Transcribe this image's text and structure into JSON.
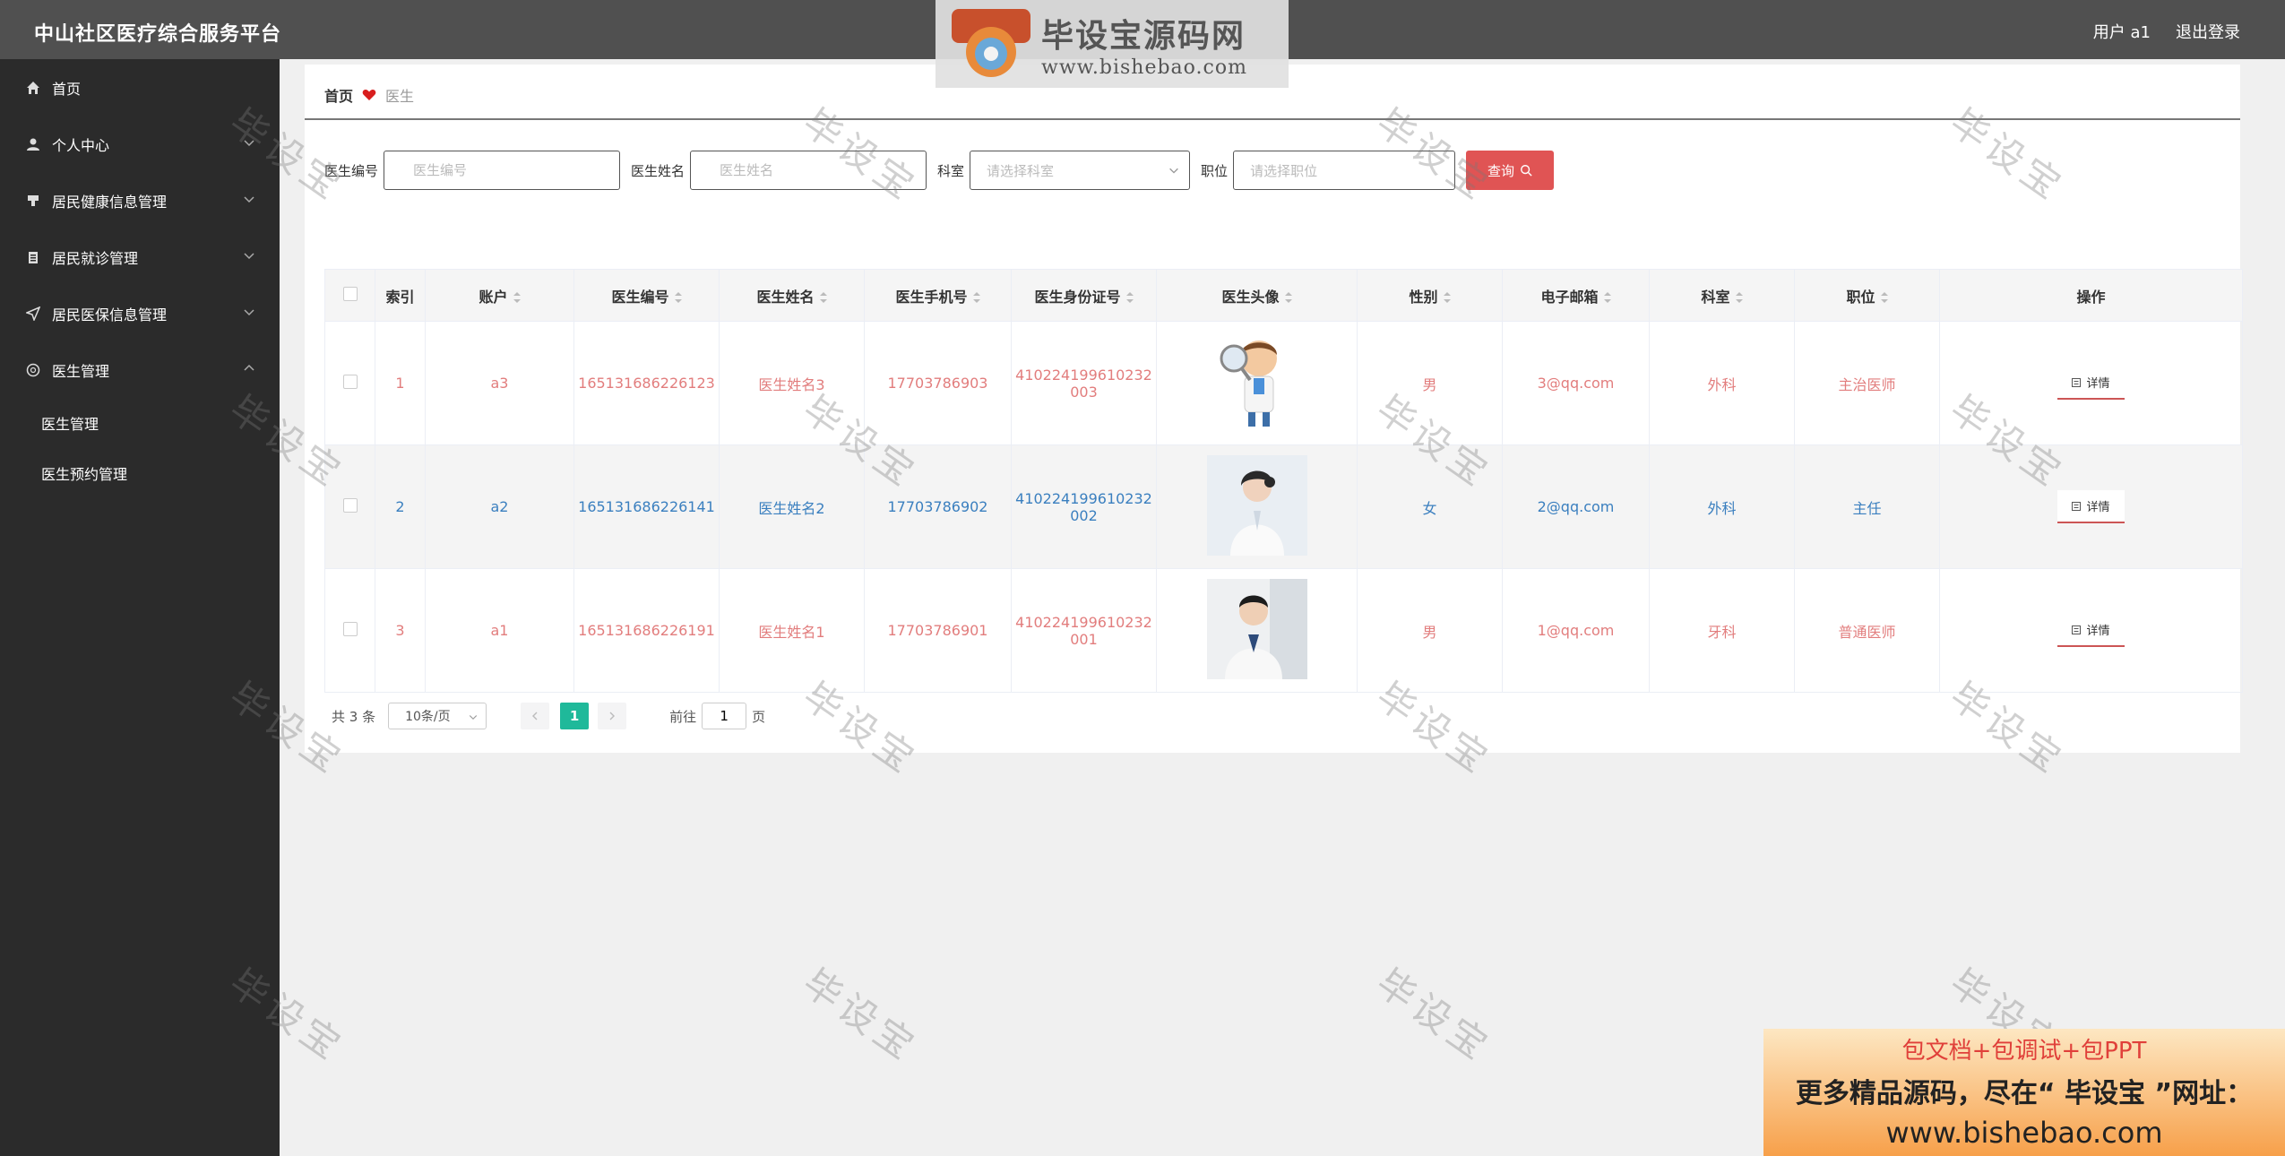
{
  "header": {
    "title": "中山社区医疗综合服务平台",
    "user": "用户 a1",
    "logout": "退出登录"
  },
  "sidebar": {
    "items": [
      {
        "label": "首页",
        "icon": "home-icon"
      },
      {
        "label": "个人中心",
        "icon": "user-icon"
      },
      {
        "label": "居民健康信息管理",
        "icon": "health-icon"
      },
      {
        "label": "居民就诊管理",
        "icon": "clipboard-icon"
      },
      {
        "label": "居民医保信息管理",
        "icon": "send-icon"
      },
      {
        "label": "医生管理",
        "icon": "circle-icon"
      }
    ],
    "subitems": [
      "医生管理",
      "医生预约管理"
    ]
  },
  "breadcrumb": {
    "home": "首页",
    "current": "医生"
  },
  "filters": {
    "doctor_no_label": "医生编号",
    "doctor_no_placeholder": "医生编号",
    "doctor_name_label": "医生姓名",
    "doctor_name_placeholder": "医生姓名",
    "dept_label": "科室",
    "dept_placeholder": "请选择科室",
    "position_label": "职位",
    "position_placeholder": "请选择职位",
    "search_label": "查询"
  },
  "table": {
    "headers": {
      "index": "索引",
      "account": "账户",
      "doctor_no": "医生编号",
      "doctor_name": "医生姓名",
      "phone": "医生手机号",
      "id_card": "医生身份证号",
      "avatar": "医生头像",
      "gender": "性别",
      "email": "电子邮箱",
      "dept": "科室",
      "position": "职位",
      "action": "操作"
    },
    "detail_label": "详情",
    "rows": [
      {
        "index": "1",
        "account": "a3",
        "doctor_no": "165131686226123",
        "doctor_name": "医生姓名3",
        "phone": "17703786903",
        "id_line1": "410224199610232",
        "id_line2": "003",
        "gender": "男",
        "email": "3@qq.com",
        "dept": "外科",
        "position": "主治医师"
      },
      {
        "index": "2",
        "account": "a2",
        "doctor_no": "165131686226141",
        "doctor_name": "医生姓名2",
        "phone": "17703786902",
        "id_line1": "410224199610232",
        "id_line2": "002",
        "gender": "女",
        "email": "2@qq.com",
        "dept": "外科",
        "position": "主任"
      },
      {
        "index": "3",
        "account": "a1",
        "doctor_no": "165131686226191",
        "doctor_name": "医生姓名1",
        "phone": "17703786901",
        "id_line1": "410224199610232",
        "id_line2": "001",
        "gender": "男",
        "email": "1@qq.com",
        "dept": "牙科",
        "position": "普通医师"
      }
    ]
  },
  "pager": {
    "total": "共 3 条",
    "page_size": "10条/页",
    "current": "1",
    "goto_prefix": "前往",
    "goto_value": "1",
    "goto_suffix": "页"
  },
  "watermark": {
    "logo_name": "毕设宝源码网",
    "logo_url": "www.bishebao.com",
    "tile": "毕设宝"
  },
  "ad": {
    "line1": "包文档+包调试+包PPT",
    "line2": "更多精品源码，尽在“ 毕设宝 ”网址：",
    "line3": "www.bishebao.com"
  },
  "colors": {
    "header_bg": "#505050",
    "sidebar_bg": "#2b2b2b",
    "accent_red": "#e05454",
    "row_red": "#e27d7d",
    "row_blue": "#3a7fbf",
    "pager_active": "#1fb99a"
  }
}
